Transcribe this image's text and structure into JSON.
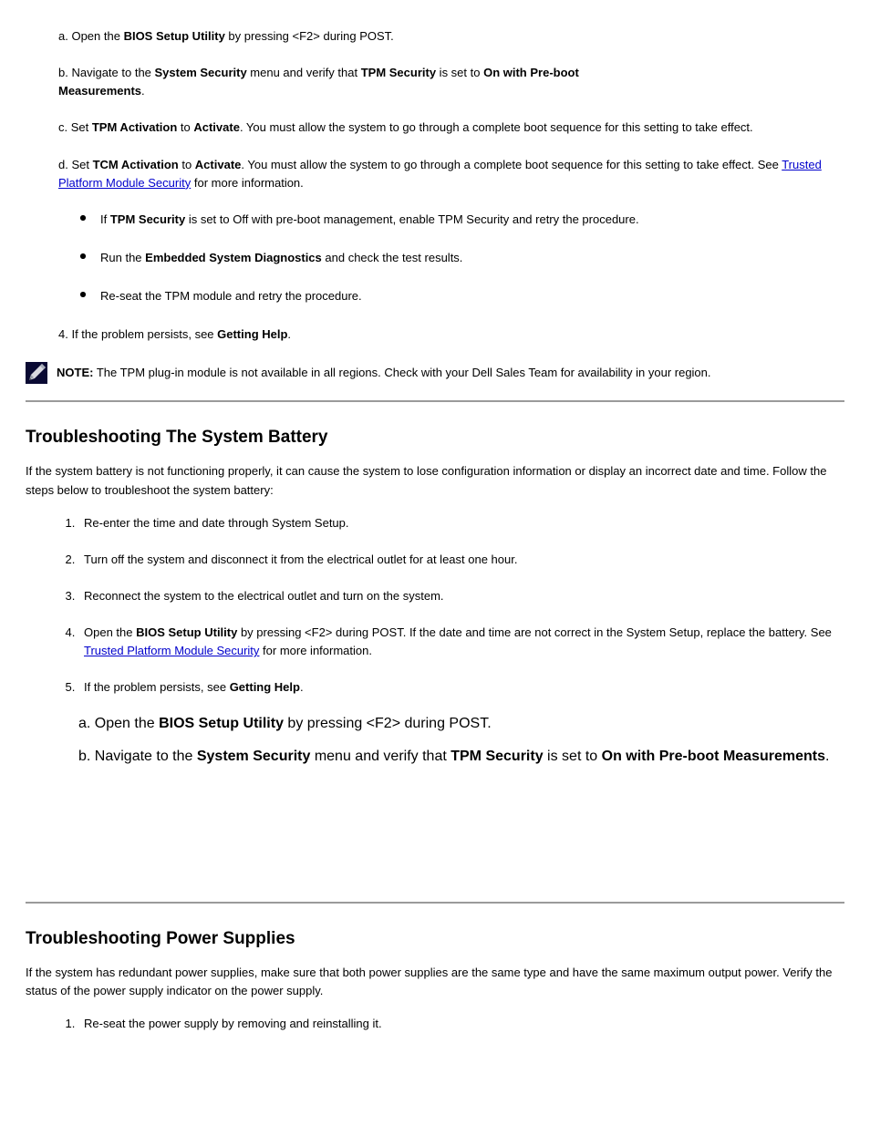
{
  "top": {
    "line_a_open": "a.  Open the ",
    "bios_setup": "BIOS Setup Utility",
    "line_a_close": " by pressing <F2> during POST.",
    "line_b_open": "b.  Navigate to the ",
    "system_security": "System Security",
    "line_b_tail": " menu and verify that ",
    "tpm_security": "TPM Security",
    "is_set_to": " is set to ",
    "on_with_pre": "On with Pre-boot",
    "measurements": "Measurements",
    "period": ".",
    "line_c_open": "c.  Set ",
    "tpm_activation": "TPM Activation",
    "to": " to ",
    "activate": "Activate",
    "line_c_tail": ". You must allow the system to go through a complete boot sequence for this setting to take effect.",
    "line_d_open": "d.  Set ",
    "tcm_activation": "TCM Activation",
    "line_d_tail": ". You must allow the system to go through a complete boot sequence for this setting to take effect. See ",
    "link_text": "Trusted Platform Module Security",
    "link_after": " for more information."
  },
  "bullets": {
    "b0_pre": "If ",
    "b0_strong": "TPM Security",
    "b0_tail": " is set to Off with pre-boot management, enable TPM Security and retry the procedure.",
    "b1_pre": "Run the ",
    "b1_strong": "Embedded System Diagnostics",
    "b1_tail": " and check the test results.",
    "b2_text": "Re-seat the TPM module and retry the procedure."
  },
  "step4_pre": "4. If the problem persists, see ",
  "step4_strong": "Getting Help",
  "step4_period": ".",
  "note": {
    "label": "NOTE:",
    "text": " The TPM plug-in module is not available in all regions. Check with your Dell Sales Team for availability in your region."
  },
  "section1": {
    "title": "Troubleshooting The System Battery",
    "body_pre": "If the system battery is not functioning properly, it can cause the system to lose configuration information or display an incorrect date and time. Follow the steps below to troubleshoot the system battery:",
    "steps": {
      "s1": "Re-enter the time and date through System Setup.",
      "s2": "Turn off the system and disconnect it from the electrical outlet for at least one hour.",
      "s3": "Reconnect the system to the electrical outlet and turn on the system.",
      "s4_pre": "Open the ",
      "s4_strong": "BIOS Setup Utility",
      "s4_tail": " by pressing <F2> during POST. If the date and time are not correct in the System Setup, replace the battery. See ",
      "s4_link": "Trusted Platform Module Security",
      "s4_after": " for more information.",
      "s5_pre": "If the problem persists, see ",
      "s5_strong": "Getting Help",
      "s5_period": "."
    },
    "sub": {
      "a_open": "a.   Open the ",
      "a_strong": "BIOS Setup Utility",
      "a_tail": " by pressing <F2> during POST.",
      "b_open": "b.   Navigate to the ",
      "b_strong1": "System Security",
      "b_mid": " menu and verify that ",
      "b_strong2": "TPM Security",
      "b_is": " is set to ",
      "b_strong3": "On with Pre-boot Measurements",
      "b_period": "."
    }
  },
  "section2": {
    "title": "Troubleshooting Power Supplies",
    "body": "If the system has redundant power supplies, make sure that both power supplies are the same type and have the same maximum output power. Verify the status of the power supply indicator on the power supply.",
    "steps": {
      "s1": "Re-seat the power supply by removing and reinstalling it."
    }
  }
}
